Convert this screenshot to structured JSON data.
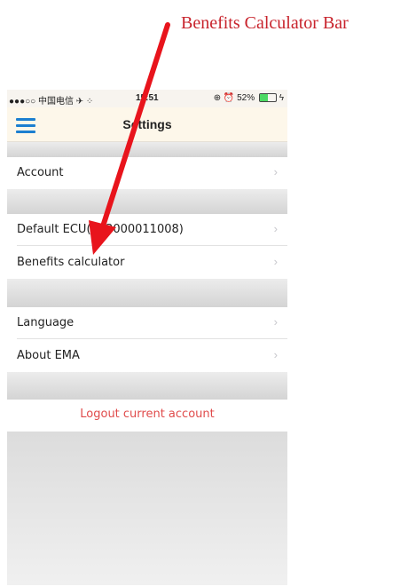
{
  "annotation": {
    "title": "Benefits Calculator Bar"
  },
  "statusbar": {
    "carrier": "●●●○○ 中国电信 ✈ ⁘",
    "time": "15:51",
    "battery": "52%",
    "battery_level": 0.52
  },
  "navbar": {
    "title": "Settings"
  },
  "rows": {
    "account": "Account",
    "default_ecu": "Default ECU(203000011008)",
    "benefits_calculator": "Benefits calculator",
    "language": "Language",
    "about": "About EMA"
  },
  "chevron": "›",
  "logout": "Logout current account",
  "colors": {
    "accent": "#1c7fd0",
    "annotation": "#c8232c",
    "logout": "#e04b4b",
    "arrow": "#e8141c"
  }
}
